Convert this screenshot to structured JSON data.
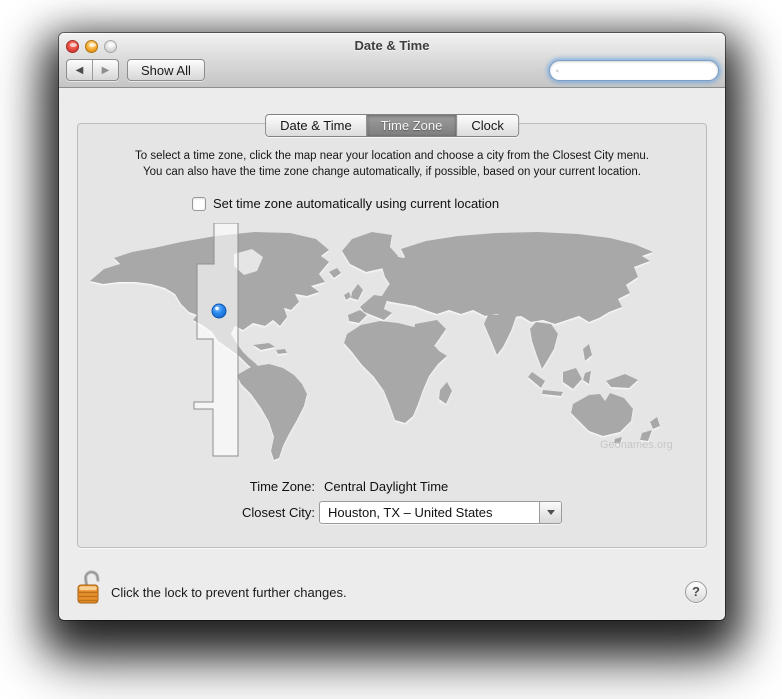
{
  "window": {
    "title": "Date & Time"
  },
  "toolbar": {
    "back_glyph": "◀",
    "forward_glyph": "▶",
    "show_all_label": "Show All",
    "search_value": "",
    "search_placeholder": ""
  },
  "tabs": [
    {
      "label": "Date & Time",
      "selected": false
    },
    {
      "label": "Time Zone",
      "selected": true
    },
    {
      "label": "Clock",
      "selected": false
    }
  ],
  "instructions": {
    "line1": "To select a time zone, click the map near your location and choose a city from the Closest City menu.",
    "line2": "You can also have the time zone change automatically, if possible, based on your current location."
  },
  "auto_timezone": {
    "label": "Set time zone automatically using current location",
    "checked": false
  },
  "map": {
    "attribution": "Geonames.org",
    "selected_zone": "US Central time zone band",
    "pin_city": "Houston, TX",
    "colors": {
      "land": "#a8a8a8",
      "ocean": "#e5e5e5",
      "pin_blue": "#1e7ee8",
      "zone_highlight": "rgba(255,255,255,0.6)"
    }
  },
  "timezone": {
    "label": "Time Zone:",
    "value": "Central Daylight Time"
  },
  "closest_city": {
    "label": "Closest City:",
    "value": "Houston, TX – United States"
  },
  "footer": {
    "lock_text": "Click the lock to prevent further changes.",
    "help_label": "?",
    "lock_color": "#e8912d"
  }
}
